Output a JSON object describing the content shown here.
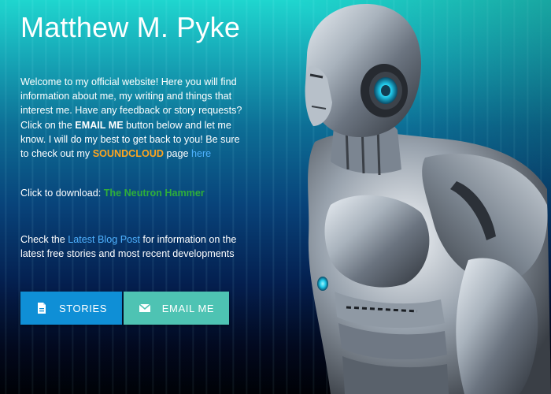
{
  "page": {
    "title": "Matthew M. Pyke"
  },
  "intro": {
    "part1": "Welcome to my official website! Here you will find information about me, my writing and things that interest me. Have any feedback or story requests? Click on the ",
    "email_emphasis": "EMAIL ME",
    "part2": " button below and let me know. I will do my best to get back to you! Be sure to check out my ",
    "soundcloud": "SOUNDCLOUD",
    "part3": " page ",
    "here_link": "here"
  },
  "download": {
    "label": "Click to download: ",
    "book": "The Neutron Hammer"
  },
  "blog": {
    "before": "Check the ",
    "link": "Latest Blog Post",
    "after": " for information on the latest free stories and most recent developments"
  },
  "buttons": {
    "stories": {
      "label": "STORIES",
      "icon": "document-icon",
      "color": "#0f8fd6"
    },
    "email": {
      "label": "EMAIL ME",
      "icon": "envelope-icon",
      "color": "#4ec3b3"
    }
  },
  "colors": {
    "accent_orange": "#ffa51f",
    "link_blue": "#4fb2ff",
    "download_green": "#2fae3a"
  }
}
